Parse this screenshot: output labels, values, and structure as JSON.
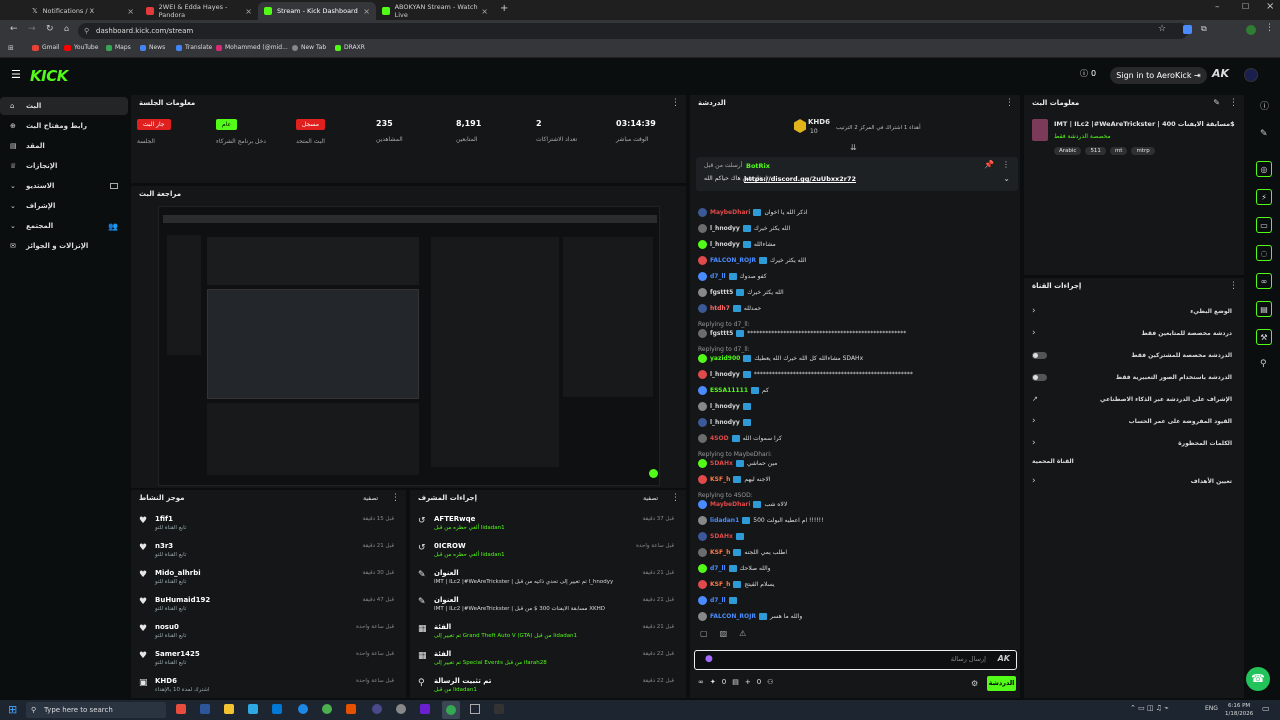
{
  "browser": {
    "tabs": [
      {
        "label": "Notifications / X",
        "color": "#ffffff"
      },
      {
        "label": "2WEI & Edda Hayes - Pandora",
        "color": "#e23b3b"
      },
      {
        "label": "Stream - Kick Dashboard",
        "color": "#53fc18"
      },
      {
        "label": "ABOKYAN Stream - Watch Live",
        "color": "#53fc18"
      }
    ],
    "url": "dashboard.kick.com/stream",
    "bookmarks": [
      "Gmail",
      "YouTube",
      "Maps",
      "News",
      "Translate",
      "Mohammed (@mid...",
      "New Tab",
      "DRAXR"
    ]
  },
  "header": {
    "logo": "KICK",
    "count": "0",
    "signin": "Sign in to AeroKick",
    "brand_color": "#53fc18"
  },
  "sidebar": {
    "items": [
      {
        "label": "البث",
        "icon": "home-icon"
      },
      {
        "label": "رابط ومفتاح البث",
        "icon": "key-icon"
      },
      {
        "label": "المقد",
        "icon": "content-icon"
      },
      {
        "label": "الإنجازات",
        "icon": "trophy-icon"
      },
      {
        "label": "الاستديو",
        "icon": "studio-icon"
      },
      {
        "label": "الإشراف",
        "icon": "shield-icon"
      },
      {
        "label": "المجتمع",
        "icon": "community-icon"
      },
      {
        "label": "الإنزالات و الجوائز",
        "icon": "gift-icon"
      }
    ]
  },
  "session": {
    "title": "معلومات الجلسة",
    "stats": [
      {
        "value": "جار البث",
        "label": "الجلسة",
        "badge_color": "#e01f1f"
      },
      {
        "value": "عام",
        "label": "دخل برنامج الشركاء",
        "badge_color": "#53fc18"
      },
      {
        "value": "مسجل",
        "label": "البث المتحد",
        "badge_color": "#e01f1f"
      },
      {
        "value": "235",
        "label": "المشاهدين"
      },
      {
        "value": "8,191",
        "label": "المتابعين"
      },
      {
        "value": "2",
        "label": "تعداد الاشتراكات"
      },
      {
        "value": "03:14:39",
        "label": "الوقت مباشر"
      }
    ]
  },
  "preview": {
    "title": "مراجعة البث"
  },
  "activity": {
    "title": "موجز النشاط",
    "filter": "تصفية",
    "items": [
      {
        "name": "1fif1",
        "sub": "تابع القناة للتو",
        "time": "قبل 15 دقيقة"
      },
      {
        "name": "n3r3",
        "sub": "تابع القناة للتو",
        "time": "قبل 21 دقيقة"
      },
      {
        "name": "Mido_alhrbi",
        "sub": "تابع القناة للتو",
        "time": "قبل 30 دقيقة"
      },
      {
        "name": "BuHumaid192",
        "sub": "تابع القناة للتو",
        "time": "قبل 47 دقيقة"
      },
      {
        "name": "nosu0",
        "sub": "تابع القناة للتو",
        "time": "قبل ساعة واحدة"
      },
      {
        "name": "Samer1425",
        "sub": "تابع القناة للتو",
        "time": "قبل ساعة واحدة"
      },
      {
        "name": "KHD6",
        "sub": "اشترك لمدة 10 بالإهداء",
        "time": "قبل ساعة واحدة"
      }
    ]
  },
  "modactions": {
    "title": "إجراءات المشرف",
    "filter": "تصفية",
    "items": [
      {
        "name": "AFTERwqe",
        "sub": "ألغي حظره من قبل lidadan1",
        "time": "قبل 37 دقيقة",
        "icon": "undo-icon"
      },
      {
        "name": "0ICROW",
        "sub": "ألغي حظره من قبل lidadan1",
        "time": "قبل ساعة واحدة",
        "icon": "undo-icon"
      },
      {
        "name": "العنوان",
        "sub": "IMT | ILc2 |#WeAreTrickster | تم تغيير إلى تحدي ذاتيه من قبل l_hnodyy",
        "time": "قبل 21 دقيقة",
        "icon": "edit-icon"
      },
      {
        "name": "العنوان",
        "sub": "IMT | ILc2 |#WeAreTrickster | مسابقة الايفنات 300 $ من قبل XKHD",
        "time": "قبل 21 دقيقة",
        "icon": "edit-icon"
      },
      {
        "name": "الفئة",
        "sub": "تم تغيير إلى Grand Theft Auto V (GTA) من قبل lidadan1",
        "time": "قبل 21 دقيقة",
        "icon": "category-icon"
      },
      {
        "name": "الفئة",
        "sub": "تم تغيير إلى Special Events من قبل ifarah28",
        "time": "قبل 22 دقيقة",
        "icon": "category-icon"
      },
      {
        "name": "تم تثبيت الرسالة",
        "sub": "من قبل lidadan1",
        "time": "قبل 22 دقيقة",
        "icon": "pin-icon"
      }
    ]
  },
  "chat": {
    "title": "الدردشة",
    "top_user": "KHD6",
    "top_rank": "10",
    "top_note": "أهداء 1 اشتراك في المركز 2 الترتيب",
    "pinned_user": "BotRix",
    "pinned_label": "أرسلت من قبل",
    "pinned_link": "https://discord.gg/2uUbxx2r72",
    "pinned_text": "ادخل دس هاك حياكم الله",
    "messages": [
      {
        "user": "MaybeDhari",
        "text": "اذكر الله يا اخوان",
        "color": "#e04a4a"
      },
      {
        "user": "l_hnodyy",
        "text": "الله يكثر خيرك",
        "color": "#d8d8d8"
      },
      {
        "user": "l_hnodyy",
        "text": "مشاءالله",
        "color": "#d8d8d8"
      },
      {
        "user": "FALCON_ROJR",
        "text": "الله يكثر خيرك",
        "color": "#4a8cff"
      },
      {
        "user": "d7_ll",
        "text": "كفو صدوك",
        "color": "#4a8cff"
      },
      {
        "user": "fgsttt5",
        "text": "الله يكثر خيرك",
        "color": "#d8d8d8"
      },
      {
        "user": "htdh7",
        "text": "حمدلله",
        "color": "#ff6b6b"
      },
      {
        "user": "fgsttt5",
        "text": "*****************************************************",
        "color": "#d8d8d8"
      },
      {
        "user": "yazid900",
        "text": "مشاءالله كل الله خيرك الله يعطيك SDAHx",
        "color": "#53fc18"
      },
      {
        "user": "l_hnodyy",
        "text": "*****************************************************",
        "color": "#d8d8d8"
      },
      {
        "user": "ESSA11111",
        "text": "كم",
        "color": "#53fc18"
      },
      {
        "user": "l_hnodyy",
        "text": "",
        "color": "#d8d8d8"
      },
      {
        "user": "l_hnodyy",
        "text": "",
        "color": "#d8d8d8"
      },
      {
        "user": "4SOD",
        "text": "كرا سموات الله",
        "color": "#e04a4a"
      },
      {
        "user": "SDAHx",
        "text": "مين حماشي",
        "color": "#e04a4a"
      },
      {
        "user": "KSF_h",
        "text": "الاجنه ليهم",
        "color": "#ff7a4a"
      },
      {
        "user": "MaybeDhari",
        "text": "لالاه شب",
        "color": "#e04a4a"
      },
      {
        "user": "lidadan1",
        "text": "500 ام اعطيه البولت !!!!!!",
        "color": "#4a8cff"
      },
      {
        "user": "SDAHx",
        "text": "",
        "color": "#e04a4a"
      },
      {
        "user": "KSF_h",
        "text": "اطلب يمي اللجنه",
        "color": "#ff7a4a"
      },
      {
        "user": "d7_ll",
        "text": "والله صلاحك",
        "color": "#4a8cff"
      },
      {
        "user": "KSF_h",
        "text": "يسلام القيتج",
        "color": "#ff7a4a"
      },
      {
        "user": "d7_ll",
        "text": "",
        "color": "#4a8cff"
      },
      {
        "user": "FALCON_ROJR",
        "text": "والله ما هسر",
        "color": "#4a8cff"
      }
    ],
    "replies": [
      "Replying to d7_ll:",
      "Replying to d7_ll:",
      "Replying to MaybeDhari:",
      "Replying to 4SOD:"
    ],
    "input_placeholder": "إرسال رسالة",
    "send_label": "الدردشة",
    "footer_count1": "0",
    "footer_count2": "0"
  },
  "streaminfo": {
    "title": "معلومات البث",
    "stream_title": "IMT | ILc2 |#WeAreTrickster | مسابقة الايفنات 400$",
    "category": "مخصصة الدردشة فقط",
    "tags": [
      "Arabic",
      "511",
      "mt",
      "mtrp"
    ]
  },
  "chatactions": {
    "title": "إجراءات القناة",
    "items": [
      {
        "label": "الوضع البطيء",
        "type": "arrow"
      },
      {
        "label": "دردشة مخصصة للمتابعين فقط",
        "type": "arrow"
      },
      {
        "label": "الدردشة مخصصة للمشتركين فقط",
        "type": "toggle"
      },
      {
        "label": "الدردشة باستخدام الصور التعبيرية فقط",
        "type": "toggle"
      },
      {
        "label": "الإشراف على الدردشة عبر الذكاء الاصطناعي",
        "type": "link"
      },
      {
        "label": "القيود المفروضة على عمر الحساب",
        "type": "arrow"
      },
      {
        "label": "الكلمات المحظورة",
        "type": "arrow"
      },
      {
        "label": "القناة المحمية",
        "type": "text"
      },
      {
        "label": "تعيين الأهداف",
        "type": "arrow"
      }
    ]
  },
  "taskbar": {
    "search_placeholder": "Type here to search",
    "lang": "ENG",
    "time": "6:16 PM",
    "date": "1/18/2026"
  }
}
